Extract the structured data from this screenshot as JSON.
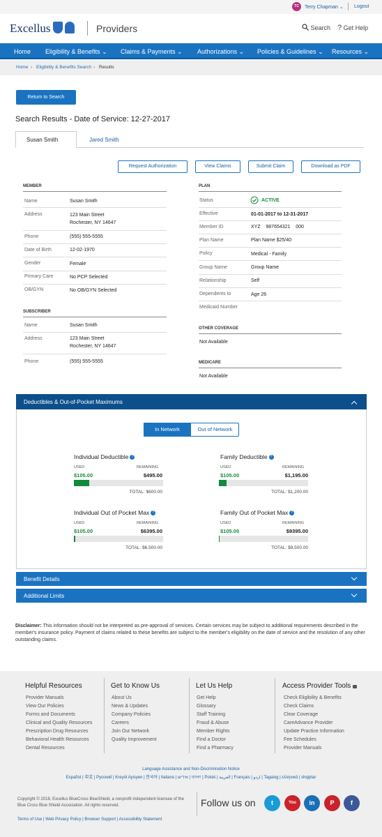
{
  "topbar": {
    "avatar_initials": "TC",
    "user_name": "Terry Chapman",
    "logout": "Logout"
  },
  "header": {
    "brand": "Excellus",
    "section": "Providers",
    "search": "Search",
    "help": "Get Help"
  },
  "nav": [
    "Home",
    "Eligibility & Benefits",
    "Claims & Payments",
    "Authorizations",
    "Policies & Guidelines",
    "Resources"
  ],
  "breadcrumb": [
    "Home",
    "Eligibility & Benefits Search",
    "Results"
  ],
  "return_button": "Return to Search",
  "results_title": "Search Results - Date of Service: 12-27-2017",
  "tabs": [
    "Susan Smith",
    "Jared Smith"
  ],
  "actions": [
    "Request Authorization",
    "View Claims",
    "Submit Claim",
    "Download as PDF"
  ],
  "member": {
    "heading": "MEMBER",
    "rows": [
      {
        "label": "Name",
        "value": "Susan Smith"
      },
      {
        "label": "Address",
        "value": "123 Main Street",
        "value2": "Rochester, NY 14647"
      },
      {
        "label": "Phone",
        "value": "(555) 555-5555"
      },
      {
        "label": "Date of Birth",
        "value": "12-02-1970"
      },
      {
        "label": "Gender",
        "value": "Female"
      },
      {
        "label": "Primary Care",
        "value": "No PCP Selected"
      },
      {
        "label": "OB/GYN",
        "value": "No OB/GYN Selected"
      }
    ]
  },
  "subscriber": {
    "heading": "SUBSCRIBER",
    "rows": [
      {
        "label": "Name",
        "value": "Susan Smith"
      },
      {
        "label": "Address",
        "value": "123 Main Street",
        "value2": "Rochester, NY 14647"
      },
      {
        "label": "Phone",
        "value": "(555) 555-5555"
      }
    ]
  },
  "plan": {
    "heading": "PLAN",
    "rows": [
      {
        "label": "Status",
        "value": "ACTIVE"
      },
      {
        "label": "Effective",
        "value": "01-01-2017 to 12-31-2017"
      },
      {
        "label": "Member ID",
        "value": "XYZ    987654321    000"
      },
      {
        "label": "Plan Name",
        "value": "Plan Name $25/40"
      },
      {
        "label": "Policy",
        "value": "Medical - Family"
      },
      {
        "label": "Group Name",
        "value": "Group Name"
      },
      {
        "label": "Relationship",
        "value": "Self"
      },
      {
        "label": "Dependents to",
        "value": "Age 26"
      },
      {
        "label": "Medicaid Number",
        "value": ""
      }
    ],
    "status_color": "#1a8a3c"
  },
  "other_coverage": {
    "heading": "OTHER COVERAGE",
    "value": "Not Available"
  },
  "medicare": {
    "heading": "MEDICARE",
    "value": "Not Available"
  },
  "deductibles": {
    "title": "Deductibles & Out-of-Pocket Maximums",
    "toggle": [
      "In Network",
      "Out of Network"
    ],
    "used_label": "USED",
    "remaining_label": "REMAINING",
    "cards": [
      {
        "title": "Individual Deductible",
        "used": "$105.00",
        "remaining": "$495.00",
        "total": "TOTAL: $600.00",
        "fraction": 0.175
      },
      {
        "title": "Family Deductible",
        "used": "$105.00",
        "remaining": "$1,195.00",
        "total": "TOTAL: $1,200.00",
        "fraction": 0.0875
      },
      {
        "title": "Individual Out of Pocket Max",
        "used": "$105.00",
        "remaining": "$6395.00",
        "total": "TOTAL: $6,500.00",
        "fraction": 0.016
      },
      {
        "title": "Family Out of Pocket Max",
        "used": "$105.00",
        "remaining": "$9395.00",
        "total": "TOTAL: $9,500.00",
        "fraction": 0.011
      }
    ]
  },
  "benefit_details": "Benefit Details",
  "additional_limits": "Additional Limits",
  "disclaimer": {
    "label": "Disclaimer:",
    "text": " This information should not be interpreted as pre-approval of services. Certain services may be subject to additional requirements described in the member's insurance policy. Payment of claims related to these benefits are subject to the member's eligibility on the date of service and the resolution of any other outstanding claims."
  },
  "footer": {
    "columns": [
      {
        "heading": "Helpful Resources",
        "links": [
          "Provider Manuals",
          "View Our Policies",
          "Forms and Documents",
          "Clinical and Quality Resources",
          "Prescription Drug Resources",
          "Behavioral Health Resources",
          "Dental Resources"
        ]
      },
      {
        "heading": "Get to Know Us",
        "links": [
          "About Us",
          "News & Updates",
          "Company Policies",
          "Careers",
          "Join Our Network",
          "Quality Improvement"
        ]
      },
      {
        "heading": "Let Us Help",
        "links": [
          "Get Help",
          "Glossary",
          "Staff Training",
          "Fraud & Abuse",
          "Member Rights",
          "Find a Doctor",
          "Find a Pharmacy"
        ]
      },
      {
        "heading": "Access Provider Tools",
        "links": [
          "Check Eligibility & Benefits",
          "Check Claims",
          "Clear Coverage",
          "CareAdvance Provider",
          "Update Practice Information",
          "Fee Schedules",
          "Provider Manuals"
        ]
      }
    ],
    "language_line": "Language Assistance and Non-Discrimination Notice",
    "languages": "Español | 中文 | Русский | Kreyòl Ayisyen | 한국어 | Italiano | אידיש | বাংলা | Polski | العربية | Français | اردو | Tagalog | ελληνικά | shqiptar",
    "copyright": "Copyright © 2018, Excellus BlueCross BlueShield, a nonprofit independent licensee of the Blue Cross Blue Shield Association. All rights reserved.",
    "follow": "Follow us on",
    "social": [
      "twitter",
      "youtube",
      "linkedin",
      "pinterest",
      "facebook"
    ],
    "bottom_links": "Terms of Use | Web Privacy Policy | Browser Support | Accessibility Statement"
  }
}
